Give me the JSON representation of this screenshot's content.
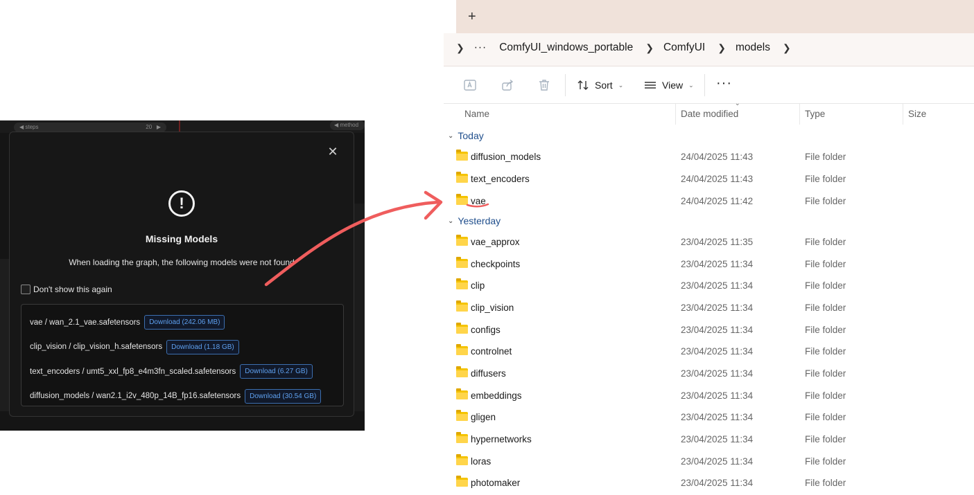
{
  "comfy": {
    "steps_label": "◀ steps",
    "steps_value": "20",
    "steps_arrow": "▶",
    "method_label": "◀ method",
    "dialog": {
      "close_glyph": "✕",
      "alert_glyph": "!",
      "title": "Missing Models",
      "description": "When loading the graph, the following models were not found",
      "dont_show_label": "Don't show this again",
      "models": [
        {
          "name": "vae / wan_2.1_vae.safetensors",
          "download": "Download (242.06 MB)"
        },
        {
          "name": "clip_vision / clip_vision_h.safetensors",
          "download": "Download (1.18 GB)"
        },
        {
          "name": "text_encoders / umt5_xxl_fp8_e4m3fn_scaled.safetensors",
          "download": "Download (6.27 GB)"
        },
        {
          "name": "diffusion_models / wan2.1_i2v_480p_14B_fp16.safetensors",
          "download": "Download (30.54 GB)"
        }
      ]
    }
  },
  "explorer": {
    "new_tab": "+",
    "breadcrumb": {
      "overflow": "···",
      "items": [
        "ComfyUI_windows_portable",
        "ComfyUI",
        "models"
      ]
    },
    "toolbar": {
      "sort_label": "Sort",
      "view_label": "View",
      "more_label": "···"
    },
    "columns": {
      "name": "Name",
      "date": "Date modified",
      "type": "Type",
      "size": "Size"
    },
    "groups": [
      {
        "label": "Today",
        "rows": [
          {
            "name": "diffusion_models",
            "date": "24/04/2025 11:43",
            "type": "File folder"
          },
          {
            "name": "text_encoders",
            "date": "24/04/2025 11:43",
            "type": "File folder"
          },
          {
            "name": "vae",
            "date": "24/04/2025 11:42",
            "type": "File folder"
          }
        ]
      },
      {
        "label": "Yesterday",
        "rows": [
          {
            "name": "vae_approx",
            "date": "23/04/2025 11:35",
            "type": "File folder"
          },
          {
            "name": "checkpoints",
            "date": "23/04/2025 11:34",
            "type": "File folder"
          },
          {
            "name": "clip",
            "date": "23/04/2025 11:34",
            "type": "File folder"
          },
          {
            "name": "clip_vision",
            "date": "23/04/2025 11:34",
            "type": "File folder"
          },
          {
            "name": "configs",
            "date": "23/04/2025 11:34",
            "type": "File folder"
          },
          {
            "name": "controlnet",
            "date": "23/04/2025 11:34",
            "type": "File folder"
          },
          {
            "name": "diffusers",
            "date": "23/04/2025 11:34",
            "type": "File folder"
          },
          {
            "name": "embeddings",
            "date": "23/04/2025 11:34",
            "type": "File folder"
          },
          {
            "name": "gligen",
            "date": "23/04/2025 11:34",
            "type": "File folder"
          },
          {
            "name": "hypernetworks",
            "date": "23/04/2025 11:34",
            "type": "File folder"
          },
          {
            "name": "loras",
            "date": "23/04/2025 11:34",
            "type": "File folder"
          },
          {
            "name": "photomaker",
            "date": "23/04/2025 11:34",
            "type": "File folder"
          }
        ]
      }
    ],
    "accent_arrow_color": "#ef5d5d",
    "folder_color": "#f5c400"
  }
}
